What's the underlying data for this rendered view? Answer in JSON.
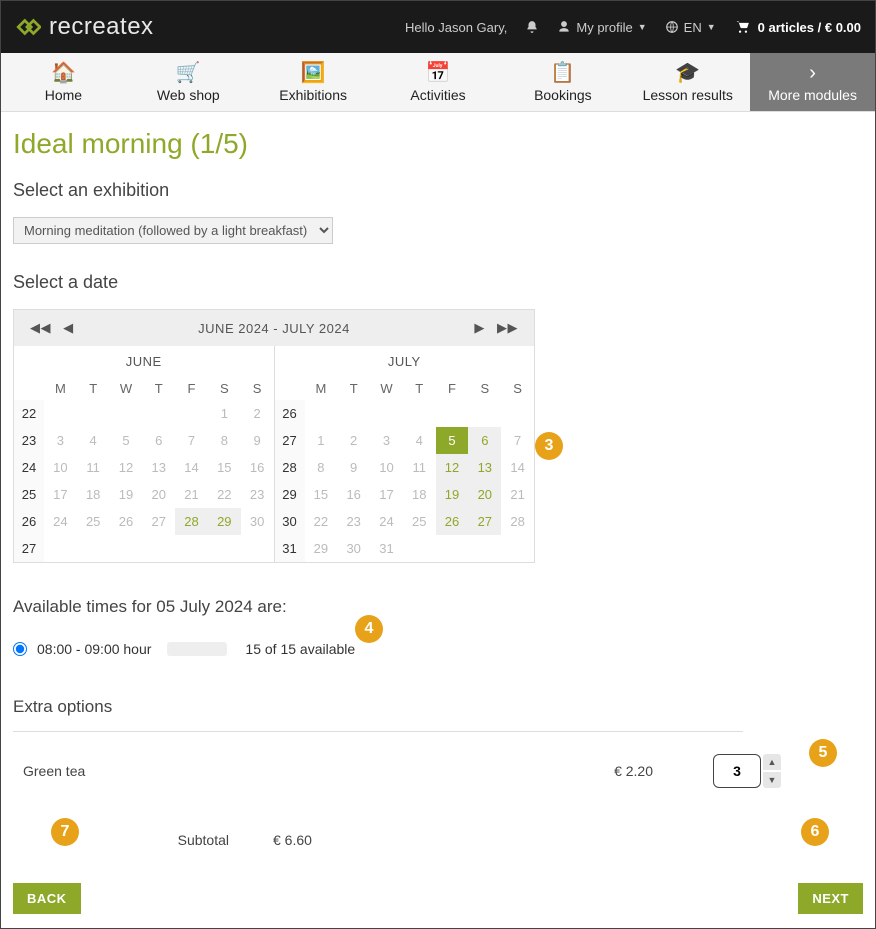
{
  "header": {
    "logo_text": "recreatex",
    "greeting": "Hello Jason Gary,",
    "profile_label": "My profile",
    "lang_label": "EN",
    "cart_text": "0 articles / € 0.00"
  },
  "nav": {
    "home": "Home",
    "webshop": "Web shop",
    "exhibitions": "Exhibitions",
    "activities": "Activities",
    "bookings": "Bookings",
    "lesson_results": "Lesson results",
    "more_modules": "More modules"
  },
  "page": {
    "title": "Ideal morning (1/5)",
    "select_exhibition_heading": "Select an exhibition",
    "exhibition_selected": "Morning meditation (followed by a light breakfast)",
    "select_date_heading": "Select a date",
    "calendar": {
      "range_label": "JUNE 2024 - JULY 2024",
      "months": [
        "JUNE",
        "JULY"
      ],
      "dows": [
        "M",
        "T",
        "W",
        "T",
        "F",
        "S",
        "S"
      ],
      "june_weeks": [
        {
          "wn": "22",
          "days": [
            "",
            "",
            "",
            "",
            "",
            "1",
            "2"
          ]
        },
        {
          "wn": "23",
          "days": [
            "3",
            "4",
            "5",
            "6",
            "7",
            "8",
            "9"
          ]
        },
        {
          "wn": "24",
          "days": [
            "10",
            "11",
            "12",
            "13",
            "14",
            "15",
            "16"
          ]
        },
        {
          "wn": "25",
          "days": [
            "17",
            "18",
            "19",
            "20",
            "21",
            "22",
            "23"
          ]
        },
        {
          "wn": "26",
          "days": [
            "24",
            "25",
            "26",
            "27",
            "28",
            "29",
            "30"
          ]
        },
        {
          "wn": "27",
          "days": [
            "",
            "",
            "",
            "",
            "",
            "",
            ""
          ]
        }
      ],
      "june_avail": [
        "28",
        "29"
      ],
      "july_weeks": [
        {
          "wn": "26",
          "days": [
            "",
            "",
            "",
            "",
            "",
            "",
            ""
          ]
        },
        {
          "wn": "27",
          "days": [
            "1",
            "2",
            "3",
            "4",
            "5",
            "6",
            "7"
          ]
        },
        {
          "wn": "28",
          "days": [
            "8",
            "9",
            "10",
            "11",
            "12",
            "13",
            "14"
          ]
        },
        {
          "wn": "29",
          "days": [
            "15",
            "16",
            "17",
            "18",
            "19",
            "20",
            "21"
          ]
        },
        {
          "wn": "30",
          "days": [
            "22",
            "23",
            "24",
            "25",
            "26",
            "27",
            "28"
          ]
        },
        {
          "wn": "31",
          "days": [
            "29",
            "30",
            "31",
            "",
            "",
            "",
            ""
          ]
        }
      ],
      "july_avail": [
        "5",
        "6",
        "12",
        "13",
        "19",
        "20",
        "26",
        "27"
      ],
      "july_selected": "5"
    },
    "times_heading": "Available times for 05 July 2024 are:",
    "timeslot": {
      "label": "08:00 - 09:00 hour",
      "availability": "15 of 15 available",
      "checked": true
    },
    "extras_heading": "Extra options",
    "extra": {
      "name": "Green tea",
      "price": "€ 2.20",
      "qty": "3"
    },
    "subtotal_label": "Subtotal",
    "subtotal_value": "€ 6.60",
    "back_label": "BACK",
    "next_label": "NEXT"
  },
  "callouts": {
    "c3": "3",
    "c4": "4",
    "c5": "5",
    "c6": "6",
    "c7": "7"
  }
}
